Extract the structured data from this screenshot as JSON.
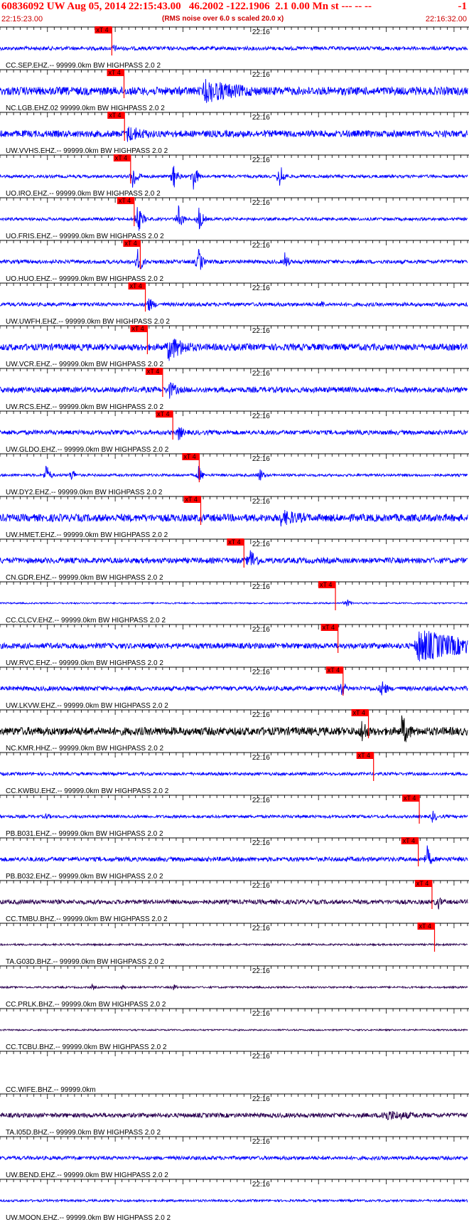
{
  "header": {
    "title": "60836092 UW Aug 05, 2014 22:15:43.00   46.2002 -122.1906  2.1 0.00 Mn st --- -- --",
    "right": "-1",
    "start_time": "22:15:23.00",
    "end_time": "22:16:32.00",
    "subtitle": "(RMS noise over 6.0 s scaled 20.0 x)"
  },
  "colors": {
    "header": "#ff0000",
    "trace_default": "#0000ff",
    "pick": "#ff0000"
  },
  "chart_data": {
    "type": "seismogram",
    "x_range": [
      "22:15:23.00",
      "22:16:32.00"
    ],
    "x_tick_label": "22:16",
    "pick_label": "xT 4",
    "traces": [
      {
        "label": "CC.SEP.EHZ.-- 99999.0km BW  HIGHPASS  2.0  2",
        "pick_time": 22.0,
        "amp": 0.1,
        "color": "#0000ff",
        "events": [
          {
            "t": 22,
            "a": 0.3,
            "d": 4
          }
        ]
      },
      {
        "label": "NC.LGB.EHZ.02 99999.0km BW  HIGHPASS  2.0  2",
        "pick_time": 24.4,
        "amp": 0.22,
        "color": "#0000ff",
        "events": [
          {
            "t": 40,
            "a": 0.7,
            "d": 30
          }
        ]
      },
      {
        "label": "UW.VVHS.EHZ.-- 99999.0km BW  HIGHPASS  2.0  2",
        "pick_time": 24.5,
        "amp": 0.18,
        "color": "#0000ff",
        "events": [
          {
            "t": 25,
            "a": 0.5,
            "d": 15
          }
        ]
      },
      {
        "label": "UO.IRO.EHZ.-- 99999.0km BW  HIGHPASS  2.0  2",
        "pick_time": 25.7,
        "amp": 0.08,
        "color": "#0000ff",
        "events": [
          {
            "t": 26,
            "a": 0.9,
            "d": 3
          },
          {
            "t": 34,
            "a": 0.9,
            "d": 2
          },
          {
            "t": 38,
            "a": 0.9,
            "d": 2
          },
          {
            "t": 55,
            "a": 0.9,
            "d": 2
          }
        ]
      },
      {
        "label": "UO.FRIS.EHZ.-- 99999.0km BW  HIGHPASS  2.0  2",
        "pick_time": 26.4,
        "amp": 0.08,
        "color": "#0000ff",
        "events": [
          {
            "t": 27,
            "a": 0.9,
            "d": 3
          },
          {
            "t": 35,
            "a": 0.9,
            "d": 2
          },
          {
            "t": 39,
            "a": 0.9,
            "d": 2
          }
        ]
      },
      {
        "label": "UO.HUO.EHZ.-- 99999.0km BW  HIGHPASS  2.0  2",
        "pick_time": 27.6,
        "amp": 0.1,
        "color": "#0000ff",
        "events": [
          {
            "t": 27,
            "a": 0.8,
            "d": 3
          },
          {
            "t": 39,
            "a": 0.9,
            "d": 2
          },
          {
            "t": 56,
            "a": 0.6,
            "d": 2
          }
        ]
      },
      {
        "label": "UW.UWFH.EHZ.-- 99999.0km BW  HIGHPASS  2.0  2",
        "pick_time": 28.6,
        "amp": 0.1,
        "color": "#0000ff",
        "events": [
          {
            "t": 29,
            "a": 0.5,
            "d": 4
          },
          {
            "t": 63,
            "a": 0.35,
            "d": 2
          }
        ]
      },
      {
        "label": "UW.VCR.EHZ.-- 99999.0km BW  HIGHPASS  2.0  2",
        "pick_time": 29.0,
        "amp": 0.18,
        "color": "#0000ff",
        "events": [
          {
            "t": 33,
            "a": 0.8,
            "d": 12
          }
        ]
      },
      {
        "label": "UW.RCS.EHZ.-- 99999.0km BW  HIGHPASS  2.0  2",
        "pick_time": 32.0,
        "amp": 0.15,
        "color": "#0000ff",
        "events": [
          {
            "t": 33,
            "a": 0.6,
            "d": 6
          }
        ]
      },
      {
        "label": "UW.GLDO.EHZ.-- 99999.0km BW  HIGHPASS  2.0  2",
        "pick_time": 34.0,
        "amp": 0.12,
        "color": "#0000ff",
        "events": [
          {
            "t": 35,
            "a": 0.6,
            "d": 3
          }
        ]
      },
      {
        "label": "UW.DY2.EHZ.-- 99999.0km BW  HIGHPASS  2.0  2",
        "pick_time": 39.2,
        "amp": 0.07,
        "color": "#0000ff",
        "events": [
          {
            "t": 9,
            "a": 0.7,
            "d": 1
          },
          {
            "t": 14,
            "a": 0.5,
            "d": 1
          },
          {
            "t": 39,
            "a": 0.6,
            "d": 2
          },
          {
            "t": 51,
            "a": 0.5,
            "d": 2
          }
        ]
      },
      {
        "label": "UW.HMET.EHZ.-- 99999.0km BW  HIGHPASS  2.0  2",
        "pick_time": 39.5,
        "amp": 0.2,
        "color": "#0000ff",
        "events": [
          {
            "t": 55,
            "a": 0.5,
            "d": 20
          }
        ]
      },
      {
        "label": "CN.GDR.EHZ.-- 99999.0km BW  HIGHPASS  2.0  2",
        "pick_time": 48.0,
        "amp": 0.15,
        "color": "#0000ff",
        "events": [
          {
            "t": 49,
            "a": 0.8,
            "d": 5
          }
        ]
      },
      {
        "label": "CC.CLCV.EHZ.-- 99999.0km BW  HIGHPASS  2.0  2",
        "pick_time": 66.0,
        "amp": 0.04,
        "color": "#0000ff",
        "events": [
          {
            "t": 68,
            "a": 0.3,
            "d": 3
          }
        ]
      },
      {
        "label": "UW.RVC.EHZ.-- 99999.0km BW  HIGHPASS  2.0  2",
        "pick_time": 66.5,
        "amp": 0.15,
        "color": "#0000ff",
        "events": [
          {
            "t": 82,
            "a": 1.0,
            "d": 35
          }
        ]
      },
      {
        "label": "UW.LKVW.EHZ.-- 99999.0km BW  HIGHPASS  2.0  2",
        "pick_time": 67.5,
        "amp": 0.12,
        "color": "#0000ff",
        "events": [
          {
            "t": 67,
            "a": 0.6,
            "d": 3
          },
          {
            "t": 75,
            "a": 0.7,
            "d": 3
          }
        ]
      },
      {
        "label": "NC.KMR.HHZ.-- 99999.0km BW  HIGHPASS  2.0  2",
        "pick_time": 72.5,
        "amp": 0.22,
        "color": "#000000",
        "events": [
          {
            "t": 71,
            "a": 0.9,
            "d": 4
          },
          {
            "t": 79,
            "a": 1.0,
            "d": 5
          }
        ]
      },
      {
        "label": "CC.KWBU.EHZ.-- 99999.0km BW  HIGHPASS  2.0  2",
        "pick_time": 73.5,
        "amp": 0.08,
        "color": "#0000ff",
        "events": []
      },
      {
        "label": "PB.B031.EHZ.-- 99999.0km BW  HIGHPASS  2.0  2",
        "pick_time": 82.5,
        "amp": 0.08,
        "color": "#0000ff",
        "events": [
          {
            "t": 9,
            "a": 0.3,
            "d": 2
          },
          {
            "t": 85,
            "a": 0.4,
            "d": 3
          }
        ]
      },
      {
        "label": "PB.B032.EHZ.-- 99999.0km BW  HIGHPASS  2.0  2",
        "pick_time": 82.3,
        "amp": 0.12,
        "color": "#0000ff",
        "events": [
          {
            "t": 84,
            "a": 0.8,
            "d": 2
          }
        ]
      },
      {
        "label": "CC.TMBU.BHZ.-- 99999.0km BW  HIGHPASS  2.0  2",
        "pick_time": 85.0,
        "amp": 0.12,
        "color": "#2a0050",
        "events": [
          {
            "t": 86,
            "a": 0.6,
            "d": 2
          }
        ]
      },
      {
        "label": "TA.G03D.BHZ.-- 99999.0km BW  HIGHPASS  2.0  2",
        "pick_time": 85.5,
        "amp": 0.05,
        "color": "#2a0050",
        "events": []
      },
      {
        "label": "CC.PRLK.BHZ.-- 99999.0km BW  HIGHPASS  2.0  2",
        "pick_time": null,
        "amp": 0.05,
        "color": "#2a0050",
        "events": [
          {
            "t": 18,
            "a": 0.2,
            "d": 2
          },
          {
            "t": 24,
            "a": 0.2,
            "d": 2
          },
          {
            "t": 34,
            "a": 0.25,
            "d": 2
          }
        ]
      },
      {
        "label": "CC.TCBU.BHZ.-- 99999.0km BW  HIGHPASS  2.0  2",
        "pick_time": null,
        "amp": 0.04,
        "color": "#2a0050",
        "events": []
      },
      {
        "label": "CC.WIFE.BHZ.-- 99999.0km",
        "pick_time": null,
        "amp": 0.0,
        "color": "#2a0050",
        "events": []
      },
      {
        "label": "TA.I05D.BHZ.-- 99999.0km BW  HIGHPASS  2.0  2",
        "pick_time": null,
        "amp": 0.12,
        "color": "#2a0050",
        "events": [
          {
            "t": 75,
            "a": 0.35,
            "d": 25
          }
        ]
      },
      {
        "label": "UW.BEND.EHZ.-- 99999.0km BW  HIGHPASS  2.0  2",
        "pick_time": null,
        "amp": 0.1,
        "color": "#0000ff",
        "events": []
      },
      {
        "label": "UW.MOON.EHZ.-- 99999.0km BW  HIGHPASS  2.0  2",
        "pick_time": null,
        "amp": 0.06,
        "color": "#0000ff",
        "events": []
      }
    ]
  }
}
